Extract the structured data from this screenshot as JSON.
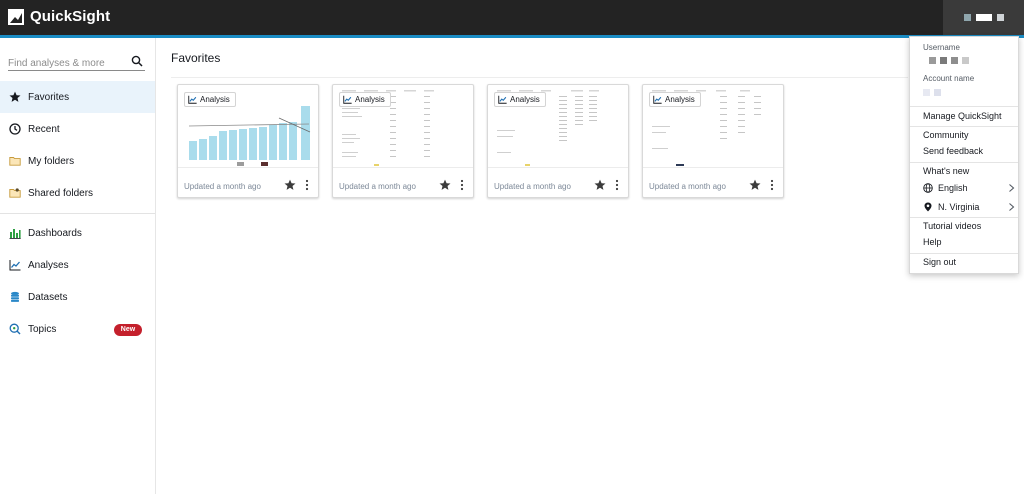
{
  "app": {
    "name": "QuickSight"
  },
  "sidebar": {
    "search_placeholder": "Find analyses & more",
    "items": [
      {
        "label": "Favorites",
        "icon": "star-icon",
        "active": true
      },
      {
        "label": "Recent",
        "icon": "clock-icon"
      },
      {
        "label": "My folders",
        "icon": "folder-icon"
      },
      {
        "label": "Shared folders",
        "icon": "shared-folder-icon"
      },
      {
        "label": "Dashboards",
        "icon": "dashboard-icon"
      },
      {
        "label": "Analyses",
        "icon": "line-chart-icon"
      },
      {
        "label": "Datasets",
        "icon": "database-icon"
      },
      {
        "label": "Topics",
        "icon": "topics-icon",
        "badge": "New"
      }
    ]
  },
  "main": {
    "title": "Favorites",
    "cards": [
      {
        "type_label": "Analysis",
        "updated": "Updated a month ago",
        "thumb": "bar-chart"
      },
      {
        "type_label": "Analysis",
        "updated": "Updated a month ago",
        "thumb": "table"
      },
      {
        "type_label": "Analysis",
        "updated": "Updated a month ago",
        "thumb": "table"
      },
      {
        "type_label": "Analysis",
        "updated": "Updated a month ago",
        "thumb": "table"
      }
    ]
  },
  "account_menu": {
    "username_label": "Username",
    "account_name_label": "Account name",
    "items": {
      "manage": "Manage QuickSight",
      "community": "Community",
      "feedback": "Send feedback",
      "whats_new": "What's new",
      "language": "English",
      "region": "N. Virginia",
      "tutorials": "Tutorial videos",
      "help": "Help",
      "sign_out": "Sign out"
    }
  },
  "colors": {
    "topbar": "#232323",
    "accent": "#1a8cc4",
    "active_nav": "#e9f3fb",
    "badge": "#c4202c",
    "bar": "#a9dcec"
  }
}
